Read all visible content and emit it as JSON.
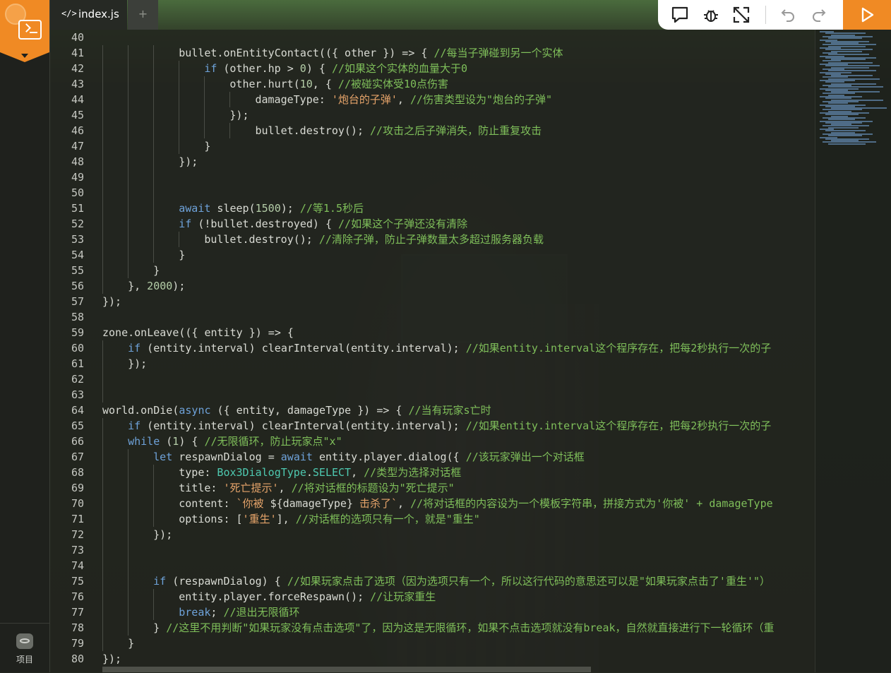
{
  "sidebar": {
    "logo_icon": "box3-logo-icon",
    "script_icon": "terminal-icon",
    "project_label": "项目"
  },
  "tabs": {
    "active": {
      "icon": "code-icon",
      "icon_text": "</>",
      "label": "index.js"
    },
    "add_label": "+"
  },
  "toolbar": {
    "buttons": [
      "comment-icon",
      "bug-icon",
      "expand-icon",
      "undo-icon",
      "redo-icon"
    ],
    "run": "play-icon",
    "accent_color": "#f08a24"
  },
  "editor": {
    "lines": [
      {
        "n": "40",
        "i": 0,
        "t": []
      },
      {
        "n": "41",
        "i": 3,
        "t": [
          [
            "",
            "bullet.onEntityContact(({ other }) => { "
          ],
          [
            "cm",
            "//每当子弹碰到另一个实体"
          ]
        ]
      },
      {
        "n": "42",
        "i": 4,
        "t": [
          [
            "kw",
            "if"
          ],
          [
            "",
            " (other.hp > "
          ],
          [
            "num",
            "0"
          ],
          [
            "",
            ") { "
          ],
          [
            "cm",
            "//如果这个实体的血量大于0"
          ]
        ]
      },
      {
        "n": "43",
        "i": 5,
        "t": [
          [
            "",
            "other.hurt("
          ],
          [
            "num",
            "10"
          ],
          [
            "",
            ", { "
          ],
          [
            "cm",
            "//被碰实体受10点伤害"
          ]
        ]
      },
      {
        "n": "44",
        "i": 6,
        "t": [
          [
            "",
            "damageType: "
          ],
          [
            "str",
            "'炮台的子弹'"
          ],
          [
            "",
            ", "
          ],
          [
            "cm",
            "//伤害类型设为\"炮台的子弹\""
          ]
        ]
      },
      {
        "n": "45",
        "i": 5,
        "t": [
          [
            "",
            "});"
          ]
        ]
      },
      {
        "n": "46",
        "i": 6,
        "t": [
          [
            "",
            "bullet.destroy(); "
          ],
          [
            "cm",
            "//攻击之后子弹消失，防止重复攻击"
          ]
        ]
      },
      {
        "n": "47",
        "i": 4,
        "t": [
          [
            "",
            "}"
          ]
        ]
      },
      {
        "n": "48",
        "i": 3,
        "t": [
          [
            "",
            "});"
          ]
        ]
      },
      {
        "n": "49",
        "i": 0,
        "t": []
      },
      {
        "n": "50",
        "i": 0,
        "t": []
      },
      {
        "n": "51",
        "i": 3,
        "t": [
          [
            "kw",
            "await"
          ],
          [
            "",
            " sleep("
          ],
          [
            "num",
            "1500"
          ],
          [
            "",
            "); "
          ],
          [
            "cm",
            "//等1.5秒后"
          ]
        ]
      },
      {
        "n": "52",
        "i": 3,
        "t": [
          [
            "kw",
            "if"
          ],
          [
            "",
            " (!bullet.destroyed) { "
          ],
          [
            "cm",
            "//如果这个子弹还没有清除"
          ]
        ]
      },
      {
        "n": "53",
        "i": 4,
        "t": [
          [
            "",
            "bullet.destroy(); "
          ],
          [
            "cm",
            "//清除子弹，防止子弹数量太多超过服务器负载"
          ]
        ]
      },
      {
        "n": "54",
        "i": 3,
        "t": [
          [
            "",
            "}"
          ]
        ]
      },
      {
        "n": "55",
        "i": 2,
        "t": [
          [
            "",
            "}"
          ]
        ]
      },
      {
        "n": "56",
        "i": 1,
        "t": [
          [
            "",
            "}, "
          ],
          [
            "num",
            "2000"
          ],
          [
            "",
            ");"
          ]
        ]
      },
      {
        "n": "57",
        "i": 0,
        "t": [
          [
            "",
            "});"
          ]
        ]
      },
      {
        "n": "58",
        "i": 0,
        "t": []
      },
      {
        "n": "59",
        "i": 0,
        "t": [
          [
            "",
            "zone.onLeave(({ entity }) => {"
          ]
        ]
      },
      {
        "n": "60",
        "i": 1,
        "t": [
          [
            "kw",
            "if"
          ],
          [
            "",
            " (entity.interval) clearInterval(entity.interval); "
          ],
          [
            "cm",
            "//如果entity.interval这个程序存在，把每2秒执行一次的子"
          ]
        ]
      },
      {
        "n": "61",
        "i": 1,
        "t": [
          [
            "",
            "});"
          ]
        ]
      },
      {
        "n": "62",
        "i": 0,
        "t": []
      },
      {
        "n": "63",
        "i": 0,
        "t": []
      },
      {
        "n": "64",
        "i": 0,
        "t": [
          [
            "",
            "world.onDie("
          ],
          [
            "kw",
            "async"
          ],
          [
            "",
            " ({ entity, damageType }) => { "
          ],
          [
            "cm",
            "//当有玩家s亡时"
          ]
        ]
      },
      {
        "n": "65",
        "i": 1,
        "t": [
          [
            "kw",
            "if"
          ],
          [
            "",
            " (entity.interval) clearInterval(entity.interval); "
          ],
          [
            "cm",
            "//如果entity.interval这个程序存在，把每2秒执行一次的子"
          ]
        ]
      },
      {
        "n": "66",
        "i": 1,
        "t": [
          [
            "kw",
            "while"
          ],
          [
            "",
            " ("
          ],
          [
            "num",
            "1"
          ],
          [
            "",
            ") { "
          ],
          [
            "cm",
            "//无限循环，防止玩家点\"x\""
          ]
        ]
      },
      {
        "n": "67",
        "i": 2,
        "t": [
          [
            "kw",
            "let"
          ],
          [
            "",
            " respawnDialog = "
          ],
          [
            "kw",
            "await"
          ],
          [
            "",
            " entity.player.dialog({ "
          ],
          [
            "cm",
            "//该玩家弹出一个对话框"
          ]
        ]
      },
      {
        "n": "68",
        "i": 3,
        "t": [
          [
            "",
            "type: "
          ],
          [
            "ty",
            "Box3DialogType"
          ],
          [
            "",
            "."
          ],
          [
            "ty",
            "SELECT"
          ],
          [
            "",
            ", "
          ],
          [
            "cm",
            "//类型为选择对话框"
          ]
        ]
      },
      {
        "n": "69",
        "i": 3,
        "t": [
          [
            "",
            "title: "
          ],
          [
            "str",
            "'死亡提示'"
          ],
          [
            "",
            ", "
          ],
          [
            "cm",
            "//将对话框的标题设为\"死亡提示\""
          ]
        ]
      },
      {
        "n": "70",
        "i": 3,
        "t": [
          [
            "",
            "content: "
          ],
          [
            "str",
            "`你被 "
          ],
          [
            "",
            "${damageType}"
          ],
          [
            "str",
            " 击杀了`"
          ],
          [
            "",
            ", "
          ],
          [
            "cm",
            "//将对话框的内容设为一个模板字符串，拼接方式为'你被' + damageType"
          ]
        ]
      },
      {
        "n": "71",
        "i": 3,
        "t": [
          [
            "",
            "options: ["
          ],
          [
            "str",
            "'重生'"
          ],
          [
            "",
            "], "
          ],
          [
            "cm",
            "//对话框的选项只有一个，就是\"重生\""
          ]
        ]
      },
      {
        "n": "72",
        "i": 2,
        "t": [
          [
            "",
            "});"
          ]
        ]
      },
      {
        "n": "73",
        "i": 0,
        "t": []
      },
      {
        "n": "74",
        "i": 0,
        "t": []
      },
      {
        "n": "75",
        "i": 2,
        "t": [
          [
            "kw",
            "if"
          ],
          [
            "",
            " (respawnDialog) { "
          ],
          [
            "cm",
            "//如果玩家点击了选项（因为选项只有一个，所以这行代码的意思还可以是\"如果玩家点击了'重生'\"）"
          ]
        ]
      },
      {
        "n": "76",
        "i": 3,
        "t": [
          [
            "",
            "entity.player.forceRespawn(); "
          ],
          [
            "cm",
            "//让玩家重生"
          ]
        ]
      },
      {
        "n": "77",
        "i": 3,
        "t": [
          [
            "kw",
            "break"
          ],
          [
            "",
            "; "
          ],
          [
            "cm",
            "//退出无限循环"
          ]
        ]
      },
      {
        "n": "78",
        "i": 2,
        "t": [
          [
            "",
            "} "
          ],
          [
            "cm",
            "//这里不用判断\"如果玩家没有点击选项\"了，因为这是无限循环，如果不点击选项就没有break，自然就直接进行下一轮循环（重"
          ]
        ]
      },
      {
        "n": "79",
        "i": 1,
        "t": [
          [
            "",
            "}"
          ]
        ]
      },
      {
        "n": "80",
        "i": 0,
        "t": [
          [
            "",
            "});"
          ]
        ]
      }
    ]
  }
}
